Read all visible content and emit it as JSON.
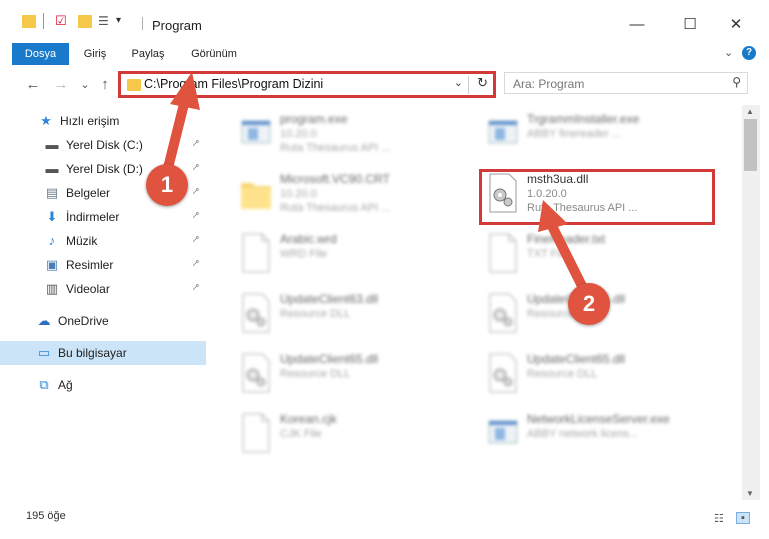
{
  "window": {
    "title": "Program",
    "minimize": "—",
    "maximize": "☐",
    "close": "✕"
  },
  "ribbon": {
    "tabs": [
      "Dosya",
      "Giriş",
      "Paylaş",
      "Görünüm"
    ],
    "expand": "⌄",
    "help": "?"
  },
  "nav": {
    "back": "←",
    "forward": "→",
    "history": "⌄",
    "up": "↑",
    "address": "C:\\Program Files\\Program Dizini",
    "address_dropdown": "⌄",
    "refresh": "↻",
    "search_placeholder": "Ara: Program",
    "search_icon": "⚲"
  },
  "sidebar": {
    "items": [
      {
        "label": "Hızlı erişim",
        "icon": "star-icon",
        "glyph": "★",
        "color": "#2f86d8",
        "pinned": false
      },
      {
        "label": "Yerel Disk (C:)",
        "icon": "drive-icon",
        "glyph": "▬",
        "color": "#555555",
        "pinned": true
      },
      {
        "label": "Yerel Disk (D:)",
        "icon": "drive-icon",
        "glyph": "▬",
        "color": "#555555",
        "pinned": true
      },
      {
        "label": "Belgeler",
        "icon": "documents-icon",
        "glyph": "▤",
        "color": "#6b7b8c",
        "pinned": true
      },
      {
        "label": "İndirmeler",
        "icon": "download-icon",
        "glyph": "⬇",
        "color": "#2f86d8",
        "pinned": true
      },
      {
        "label": "Müzik",
        "icon": "music-icon",
        "glyph": "♪",
        "color": "#2f86d8",
        "pinned": true
      },
      {
        "label": "Resimler",
        "icon": "pictures-icon",
        "glyph": "▣",
        "color": "#4a7fb5",
        "pinned": true
      },
      {
        "label": "Videolar",
        "icon": "video-icon",
        "glyph": "▥",
        "color": "#555555",
        "pinned": true
      },
      {
        "label": "OneDrive",
        "icon": "cloud-icon",
        "glyph": "☁",
        "color": "#2f6fc0",
        "pinned": false
      },
      {
        "label": "Bu bilgisayar",
        "icon": "computer-icon",
        "glyph": "▭",
        "color": "#2f86d8",
        "pinned": false
      },
      {
        "label": "Ağ",
        "icon": "network-icon",
        "glyph": "⧉",
        "color": "#2f86d8",
        "pinned": false
      }
    ],
    "pin_glyph": "📌"
  },
  "files": [
    {
      "name": "program.exe",
      "line1": "10.20.0",
      "line2": "Ruta Thesaurus API ...",
      "blurred": true
    },
    {
      "name": "TrgrammInstaller.exe",
      "line1": "ABBY finereader ...",
      "line2": "",
      "blurred": true
    },
    {
      "name": "Microsoft.VC90.CRT",
      "line1": "10.20.0",
      "line2": "Ruta Thesaurus API ...",
      "blurred": true
    },
    {
      "name": "msth3ua.dll",
      "line1": "1.0.20.0",
      "line2": "Ruta Thesaurus API ...",
      "blurred": false
    },
    {
      "name": "Arabic.wrd",
      "line1": "WRD File",
      "line2": "",
      "blurred": true
    },
    {
      "name": "FineReader.txt",
      "line1": "TXT File",
      "line2": "",
      "blurred": true
    },
    {
      "name": "UpdateClient63.dll",
      "line1": "Resource DLL",
      "line2": "",
      "blurred": true
    },
    {
      "name": "UpdateClient65.dll",
      "line1": "Resource DLL",
      "line2": "",
      "blurred": true
    },
    {
      "name": "UpdateClient65.dll",
      "line1": "Resource DLL",
      "line2": "",
      "blurred": true
    },
    {
      "name": "UpdateClient65.dll",
      "line1": "Resource DLL",
      "line2": "",
      "blurred": true
    },
    {
      "name": "Korean.cjk",
      "line1": "CJK File",
      "line2": "",
      "blurred": true
    },
    {
      "name": "NetworkLicenseServer.exe",
      "line1": "ABBY network licens...",
      "line2": "",
      "blurred": true
    }
  ],
  "status": {
    "count": "195 öğe"
  },
  "annotations": {
    "step1": "1",
    "step2": "2",
    "color": "#e0533f"
  }
}
